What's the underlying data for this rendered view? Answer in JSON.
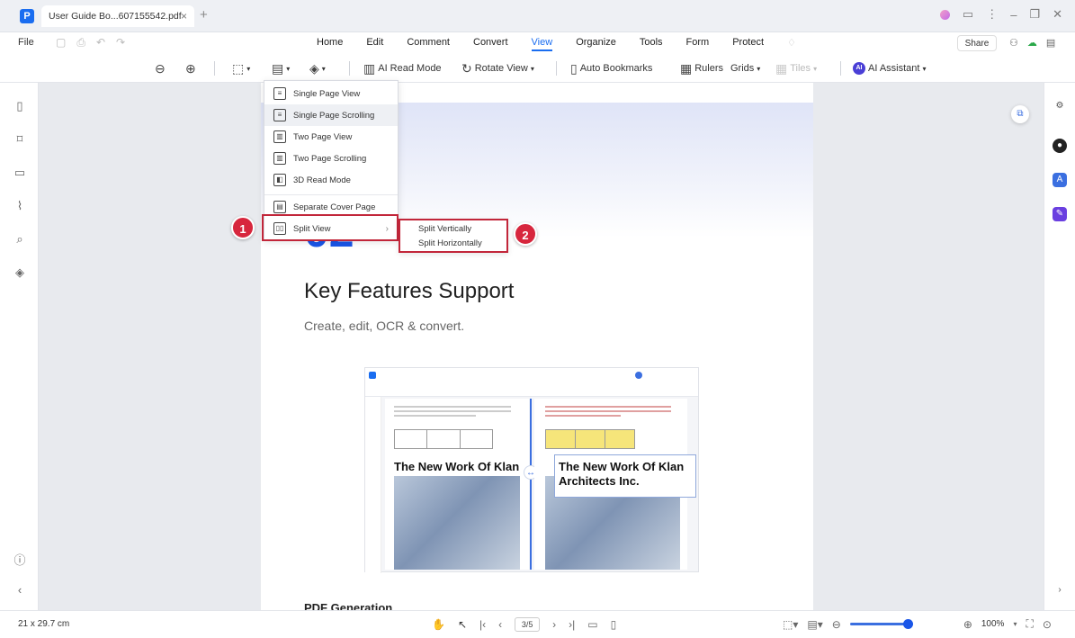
{
  "titlebar": {
    "tab_title": "User Guide Bo...607155542.pdf",
    "tab_close": "×",
    "new_tab": "+"
  },
  "menubar": {
    "file": "File",
    "items": [
      "Home",
      "Edit",
      "Comment",
      "Convert",
      "View",
      "Organize",
      "Tools",
      "Form",
      "Protect"
    ],
    "active": "View",
    "share": "Share"
  },
  "toolbar": {
    "ai_read_mode": "AI Read Mode",
    "rotate_view": "Rotate View",
    "auto_bookmarks": "Auto Bookmarks",
    "rulers": "Rulers",
    "grids": "Grids",
    "tiles": "Tiles",
    "ai_assistant": "AI Assistant",
    "ai_badge": "AI"
  },
  "dropdown": {
    "items": [
      "Single Page View",
      "Single Page Scrolling",
      "Two Page View",
      "Two Page Scrolling",
      "3D Read Mode",
      "Separate Cover Page",
      "Split View"
    ],
    "highlighted": "Single Page Scrolling"
  },
  "submenu": {
    "items": [
      "Split Vertically",
      "Split Horizontally"
    ]
  },
  "badges": [
    "1",
    "2"
  ],
  "page": {
    "big_number": "02",
    "title": "Key Features Support",
    "subtitle": "Create, edit, OCR & convert.",
    "footer_title": "PDF Generation",
    "embed_text_left": "The New Work Of Klan Architects Inc.",
    "embed_text_right": "The New Work Of Klan Architects Inc."
  },
  "statusbar": {
    "page_size": "21 x 29.7 cm",
    "page_number": "3/5",
    "zoom": "100%"
  }
}
